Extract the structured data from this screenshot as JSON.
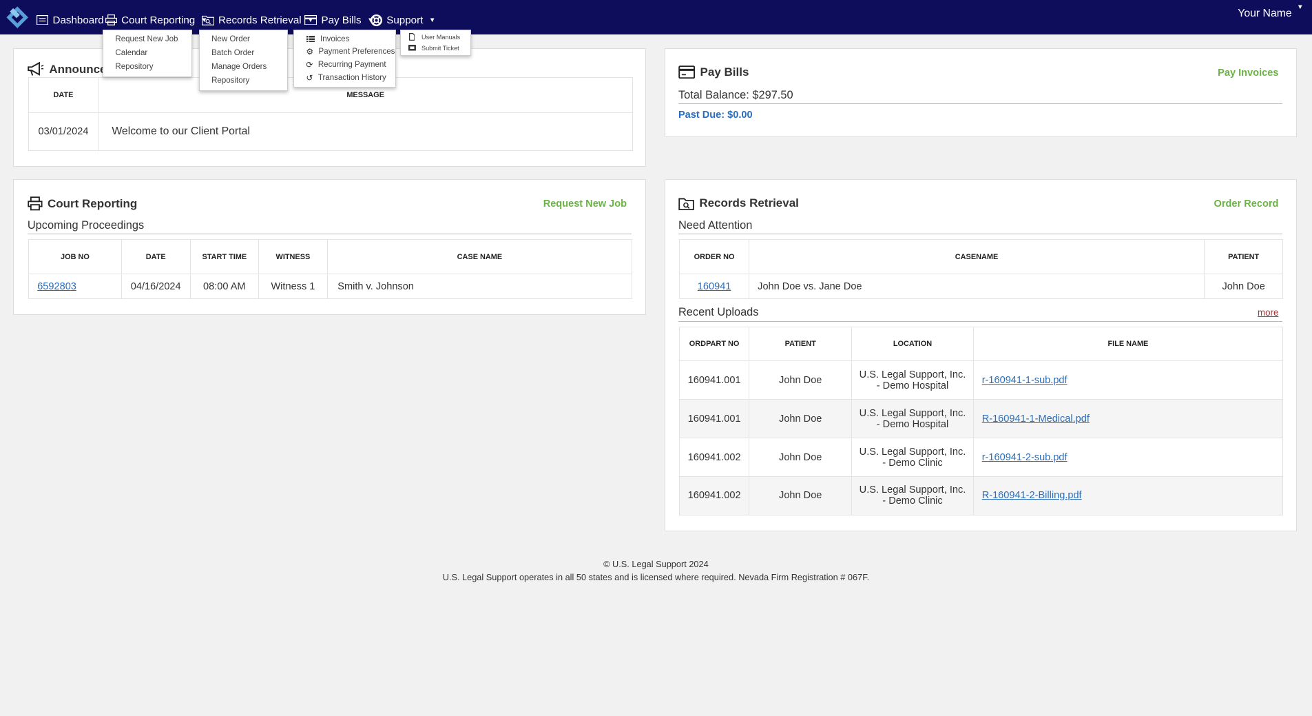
{
  "nav": {
    "dashboard": "Dashboard",
    "court_reporting": "Court Reporting",
    "records_retrieval": "Records Retrieval",
    "pay_bills": "Pay Bills",
    "support": "Support",
    "user_name": "Your Name"
  },
  "menus": {
    "court_reporting": [
      "Request New Job",
      "Calendar",
      "Repository"
    ],
    "records_retrieval": [
      "New Order",
      "Batch Order",
      "Manage Orders",
      "Repository"
    ],
    "pay_bills": [
      {
        "label": "Invoices",
        "icon": "list-icon"
      },
      {
        "label": "Payment Preferences",
        "icon": "gear-icon"
      },
      {
        "label": "Recurring Payment",
        "icon": "refresh-icon"
      },
      {
        "label": "Transaction History",
        "icon": "history-icon"
      }
    ],
    "support": [
      {
        "label": "User Manuals",
        "icon": "document-icon"
      },
      {
        "label": "Submit Ticket",
        "icon": "ticket-icon"
      }
    ]
  },
  "announcements": {
    "title": "Announce",
    "headers": [
      "DATE",
      "MESSAGE"
    ],
    "rows": [
      {
        "date": "03/01/2024",
        "message": "Welcome to our Client Portal"
      }
    ]
  },
  "pay_bills": {
    "title": "Pay Bills",
    "link": "Pay Invoices",
    "total_balance": "Total Balance: $297.50",
    "past_due": "Past Due: $0.00"
  },
  "court_reporting": {
    "title": "Court Reporting",
    "link": "Request New Job",
    "subhead": "Upcoming Proceedings",
    "headers": [
      "JOB NO",
      "DATE",
      "START TIME",
      "WITNESS",
      "CASE NAME"
    ],
    "rows": [
      {
        "job_no": "6592803",
        "date": "04/16/2024",
        "start_time": "08:00 AM",
        "witness": "Witness 1",
        "case_name": "Smith v. Johnson"
      }
    ]
  },
  "records_retrieval": {
    "title": "Records Retrieval",
    "link": "Order Record",
    "subhead_attention": "Need Attention",
    "attention_headers": [
      "ORDER NO",
      "CASENAME",
      "PATIENT"
    ],
    "attention_rows": [
      {
        "order_no": "160941",
        "casename": "John Doe vs. Jane Doe",
        "patient": "John Doe"
      }
    ],
    "subhead_uploads": "Recent Uploads",
    "more": "more",
    "upload_headers": [
      "ORDPART NO",
      "PATIENT",
      "LOCATION",
      "FILE NAME"
    ],
    "upload_rows": [
      {
        "ordpart": "160941.001",
        "patient": "John Doe",
        "loc1": "U.S. Legal Support, Inc.",
        "loc2": "- Demo Hospital",
        "file": "r-160941-1-sub.pdf"
      },
      {
        "ordpart": "160941.001",
        "patient": "John Doe",
        "loc1": "U.S. Legal Support, Inc.",
        "loc2": "- Demo Hospital",
        "file": "R-160941-1-Medical.pdf"
      },
      {
        "ordpart": "160941.002",
        "patient": "John Doe",
        "loc1": "U.S. Legal Support, Inc.",
        "loc2": "- Demo Clinic",
        "file": "r-160941-2-sub.pdf"
      },
      {
        "ordpart": "160941.002",
        "patient": "John Doe",
        "loc1": "U.S. Legal Support, Inc.",
        "loc2": "- Demo Clinic",
        "file": "R-160941-2-Billing.pdf"
      }
    ]
  },
  "footer": {
    "copyright": "© U.S. Legal Support 2024",
    "note": "U.S. Legal Support operates in all 50 states and is licensed where required. Nevada Firm Registration # 067F."
  },
  "colors": {
    "nav_bg": "#0d0d5c",
    "accent_green": "#6ab344",
    "link_blue": "#2a6ebb",
    "past_due_blue": "#2a6ebb"
  }
}
